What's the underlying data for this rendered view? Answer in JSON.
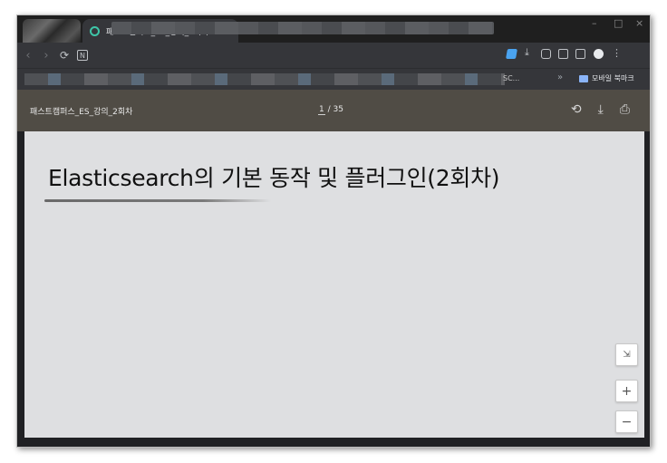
{
  "browser": {
    "tab": {
      "title": "패스트캠퍼스_ES_강의_2회차",
      "close_glyph": "×"
    },
    "new_tab_glyph": "+",
    "window_controls": {
      "minimize": "–",
      "maximize": "□",
      "close": "×"
    },
    "nav": {
      "back": "‹",
      "forward": "›",
      "reload": "⟳",
      "naver": "N"
    },
    "bookmarks": {
      "truncated_label": "SC...",
      "overflow": "»",
      "folder_label": "모바일 북마크"
    }
  },
  "pdf_viewer": {
    "title": "패스트캠퍼스_ES_강의_2회차",
    "current_page": "1",
    "page_separator": " / 35",
    "actions": {
      "rotate": "⟲",
      "download": "⤓",
      "print": "⎙"
    },
    "zoom": {
      "fit": "⇲",
      "zoom_in": "+",
      "zoom_out": "−"
    }
  },
  "slide": {
    "heading": "Elasticsearch의 기본 동작 및 플러그인(2회차)"
  },
  "colors": {
    "tab_favicon": "#3ec6a8",
    "pdf_toolbar": "#504c45",
    "page_background": "#dedfe1"
  }
}
